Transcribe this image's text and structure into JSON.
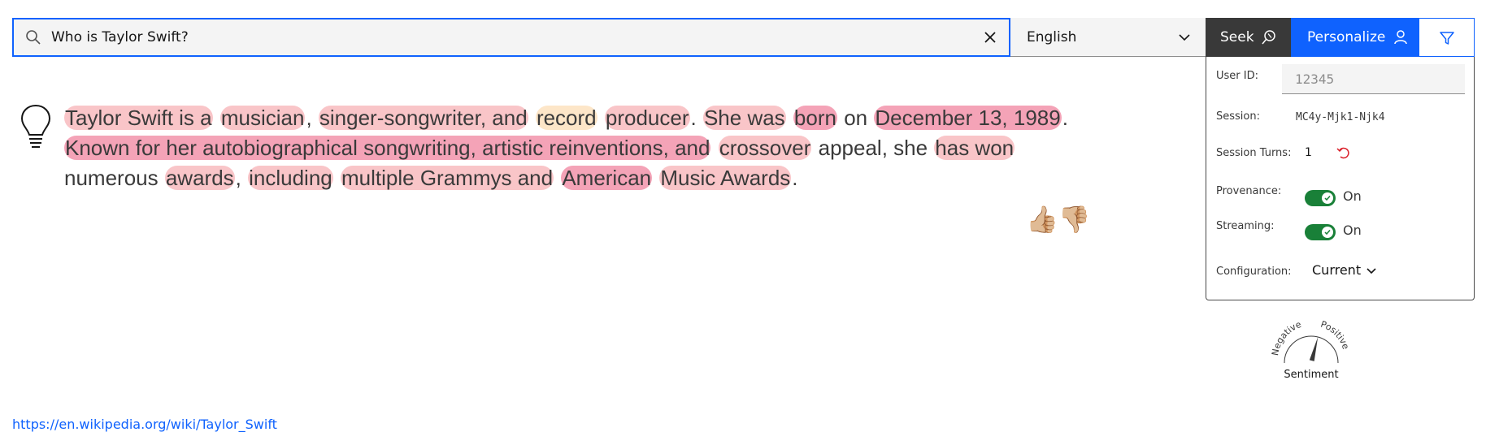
{
  "search": {
    "query": "Who is Taylor Swift?"
  },
  "language": {
    "selected": "English"
  },
  "buttons": {
    "seek": "Seek",
    "personalize": "Personalize"
  },
  "answer": {
    "segments": [
      {
        "text": "Taylor Swift is a",
        "level": 1
      },
      {
        "text": " ",
        "level": 0
      },
      {
        "text": "musician",
        "level": 1
      },
      {
        "text": ", ",
        "level": 0
      },
      {
        "text": "singer-songwriter, and",
        "level": 1
      },
      {
        "text": " ",
        "level": 0
      },
      {
        "text": "record",
        "level": 3
      },
      {
        "text": " ",
        "level": 0
      },
      {
        "text": "producer",
        "level": 1
      },
      {
        "text": ". ",
        "level": 0
      },
      {
        "text": "She was",
        "level": 1
      },
      {
        "text": " ",
        "level": 0
      },
      {
        "text": "born",
        "level": 2
      },
      {
        "text": " on ",
        "level": 0
      },
      {
        "text": "December 13, 1989",
        "level": 2
      },
      {
        "text": ". ",
        "level": 0
      },
      {
        "text": "Known for her autobiographical songwriting, artistic reinventions, and",
        "level": 2
      },
      {
        "text": " ",
        "level": 0
      },
      {
        "text": "crossover",
        "level": 1
      },
      {
        "text": " appeal, she ",
        "level": 0
      },
      {
        "text": "has won",
        "level": 1
      },
      {
        "text": " numerous ",
        "level": 0
      },
      {
        "text": "awards",
        "level": 1
      },
      {
        "text": ", ",
        "level": 0
      },
      {
        "text": "including",
        "level": 1
      },
      {
        "text": " ",
        "level": 0
      },
      {
        "text": "multiple Grammys and",
        "level": 1
      },
      {
        "text": " ",
        "level": 0
      },
      {
        "text": "American",
        "level": 2
      },
      {
        "text": " ",
        "level": 0
      },
      {
        "text": "Music Awards",
        "level": 1
      },
      {
        "text": ".",
        "level": 0
      }
    ],
    "highlight_colors": {
      "1": "#f9c5c8",
      "2": "#f4a3b7",
      "3": "#fde6c8"
    }
  },
  "feedback": {
    "thumbs_up": "👍🏼",
    "thumbs_down": "👎🏼"
  },
  "panel": {
    "user_id_label": "User ID:",
    "user_id_placeholder": "12345",
    "session_label": "Session:",
    "session_value": "MC4y-Mjk1-Njk4",
    "session_turns_label": "Session Turns:",
    "session_turns_value": "1",
    "provenance_label": "Provenance:",
    "provenance_state": "On",
    "streaming_label": "Streaming:",
    "streaming_state": "On",
    "configuration_label": "Configuration:",
    "configuration_value": "Current"
  },
  "sentiment": {
    "negative_label": "Negative",
    "positive_label": "Positive",
    "caption": "Sentiment",
    "value": 0.58
  },
  "source": {
    "url": "https://en.wikipedia.org/wiki/Taylor_Swift"
  },
  "colors": {
    "primary": "#0f62fe",
    "seek_bg": "#393939",
    "toggle_on": "#198038",
    "reset_icon": "#da1e28"
  }
}
